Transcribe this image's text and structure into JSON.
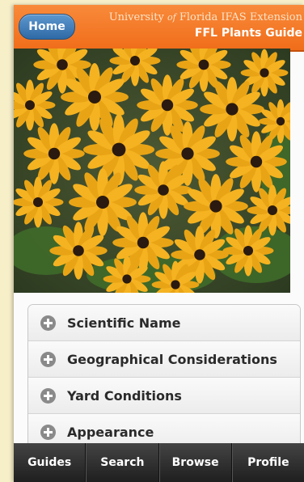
{
  "header": {
    "home_label": "Home",
    "org_line_pre": "University",
    "org_line_of": "of",
    "org_line_post": "Florida  IFAS Extension",
    "app_title": "FFL Plants Guide"
  },
  "sections": [
    {
      "label": "Scientific Name"
    },
    {
      "label": "Geographical Considerations"
    },
    {
      "label": "Yard Conditions"
    },
    {
      "label": "Appearance"
    }
  ],
  "nav": [
    {
      "label": "Guides"
    },
    {
      "label": "Search"
    },
    {
      "label": "Browse"
    },
    {
      "label": "Profile"
    }
  ],
  "colors": {
    "header_orange": "#f06d1a",
    "home_blue": "#2f6aa6",
    "flower_yellow": "#f5b321",
    "navbar_dark": "#1f1f1f"
  },
  "photo": {
    "subject": "yellow-black-eyed-susan-flowers"
  }
}
